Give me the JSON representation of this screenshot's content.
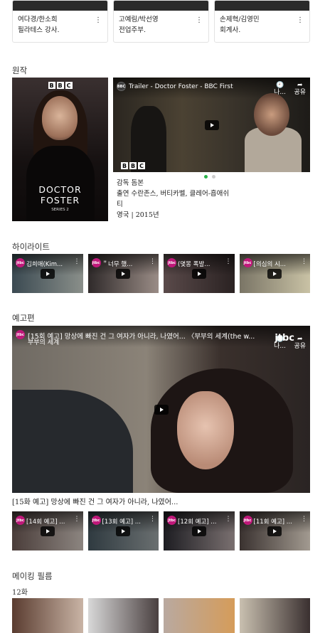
{
  "cast": [
    {
      "name": "여다경/한소희",
      "role": "필라테스 강사."
    },
    {
      "name": "고예림/박선영",
      "role": "전업주부."
    },
    {
      "name": "손제혁/김영민",
      "role": "회계사."
    }
  ],
  "sections": {
    "original": "원작",
    "highlights": "하이라이트",
    "trailers": "예고편",
    "making": "메이킹 필름",
    "episode": "12화"
  },
  "poster": {
    "brand": [
      "B",
      "B",
      "C"
    ],
    "title_line1": "DOCTOR",
    "title_line2": "FOSTER",
    "subtitle": "SERIES 2"
  },
  "original_video": {
    "channel": "BBC",
    "title": "Trailer - Doctor Foster - BBC First",
    "watch_later": "나...",
    "share": "공유"
  },
  "original_info": {
    "director": "감독 돔본",
    "cast_line1": "출연 수란존스, 버티카벨, 클레어-흡애쉬",
    "cast_line2": "티",
    "meta": "영국 | 2015년"
  },
  "highlights": [
    {
      "title": "김희애(Kim..."
    },
    {
      "title": "＂너무 했..."
    },
    {
      "title": "(몇몽 폭발..."
    },
    {
      "title": "[의심의 시..."
    }
  ],
  "main_trailer": {
    "title": "[15회 예고] 망상에 빠진 건 그 여자가 아니라, 나였어... 〈부부의 세계(the w...",
    "watermark": "부부의 세계",
    "logo": "jtbc",
    "watch_later": "나...",
    "share": "공유",
    "caption": "[15화 예고] 망상에 빠진 건 그 여자가 아니라, 나였어..."
  },
  "trailers": [
    {
      "title": "[14회 예고] ..."
    },
    {
      "title": "[13회 예고] ..."
    },
    {
      "title": "[12회 예고] ..."
    },
    {
      "title": "[11회 예고] ..."
    }
  ],
  "icons": {
    "more": "⋮",
    "clock": "🕘",
    "share": "➦"
  }
}
